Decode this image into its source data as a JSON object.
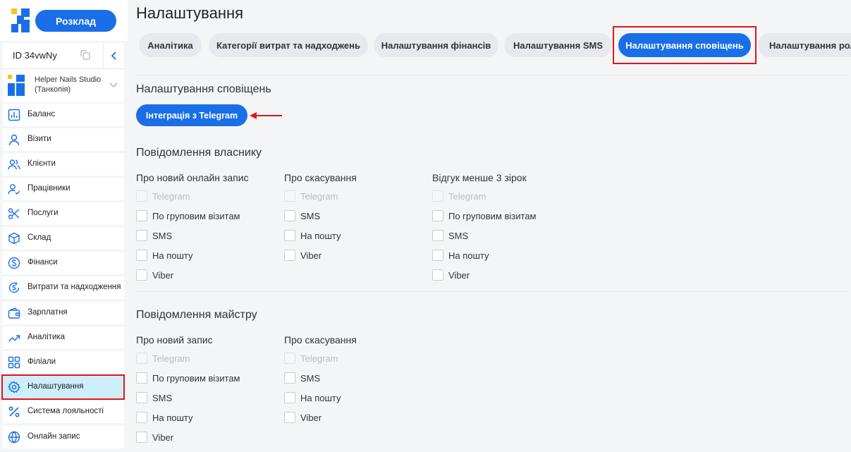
{
  "sidebar": {
    "schedule_label": "Розклад",
    "account_id": "ID 34vwNy",
    "studio_name": "Helper Nails Studio (Танкопія)",
    "items": [
      {
        "label": "Баланс",
        "icon": "bar-chart-icon"
      },
      {
        "label": "Візити",
        "icon": "user-icon"
      },
      {
        "label": "Клієнти",
        "icon": "users-icon"
      },
      {
        "label": "Працівники",
        "icon": "user-check-icon"
      },
      {
        "label": "Послуги",
        "icon": "scissors-icon"
      },
      {
        "label": "Склад",
        "icon": "box-icon"
      },
      {
        "label": "Фінанси",
        "icon": "dollar-icon"
      },
      {
        "label": "Витрати та надходження",
        "icon": "dollar-cycle-icon"
      },
      {
        "label": "Зарплатня",
        "icon": "wallet-icon"
      },
      {
        "label": "Аналітика",
        "icon": "trend-up-icon"
      },
      {
        "label": "Філіали",
        "icon": "grid-icon"
      },
      {
        "label": "Налаштування",
        "icon": "gear-icon",
        "active": true
      },
      {
        "label": "Система лояльності",
        "icon": "percent-icon"
      },
      {
        "label": "Онлайн запис",
        "icon": "globe-icon"
      }
    ]
  },
  "main": {
    "title": "Налаштування",
    "tabs": [
      {
        "label": "Аналітика"
      },
      {
        "label": "Категорії витрат та надходжень"
      },
      {
        "label": "Налаштування фінансів"
      },
      {
        "label": "Налаштування SMS"
      },
      {
        "label": "Налаштування сповіщень",
        "active": true
      },
      {
        "label": "Налаштування рол"
      }
    ],
    "notifications_heading": "Налаштування сповіщень",
    "telegram_button": "Інтеграція з Telegram",
    "owner": {
      "heading": "Повідомлення власнику",
      "columns": [
        {
          "title": "Про новий онлайн запис",
          "options": [
            "Telegram",
            "По груповим візитам",
            "SMS",
            "На пошту",
            "Viber"
          ]
        },
        {
          "title": "Про скасування",
          "options": [
            "Telegram",
            "SMS",
            "На пошту",
            "Viber"
          ]
        },
        {
          "title": "Відгук менше 3 зірок",
          "options": [
            "Telegram",
            "По груповим візитам",
            "SMS",
            "На пошту",
            "Viber"
          ]
        }
      ]
    },
    "master": {
      "heading": "Повідомлення майстру",
      "columns": [
        {
          "title": "Про новий запис",
          "options": [
            "Telegram",
            "По груповим візитам",
            "SMS",
            "На пошту",
            "Viber"
          ]
        },
        {
          "title": "Про скасування",
          "options": [
            "Telegram",
            "SMS",
            "На пошту",
            "Viber"
          ]
        }
      ]
    }
  },
  "colors": {
    "accent": "#1a6fe8",
    "highlight": "#e3141b",
    "active_nav": "#cfeefc"
  }
}
